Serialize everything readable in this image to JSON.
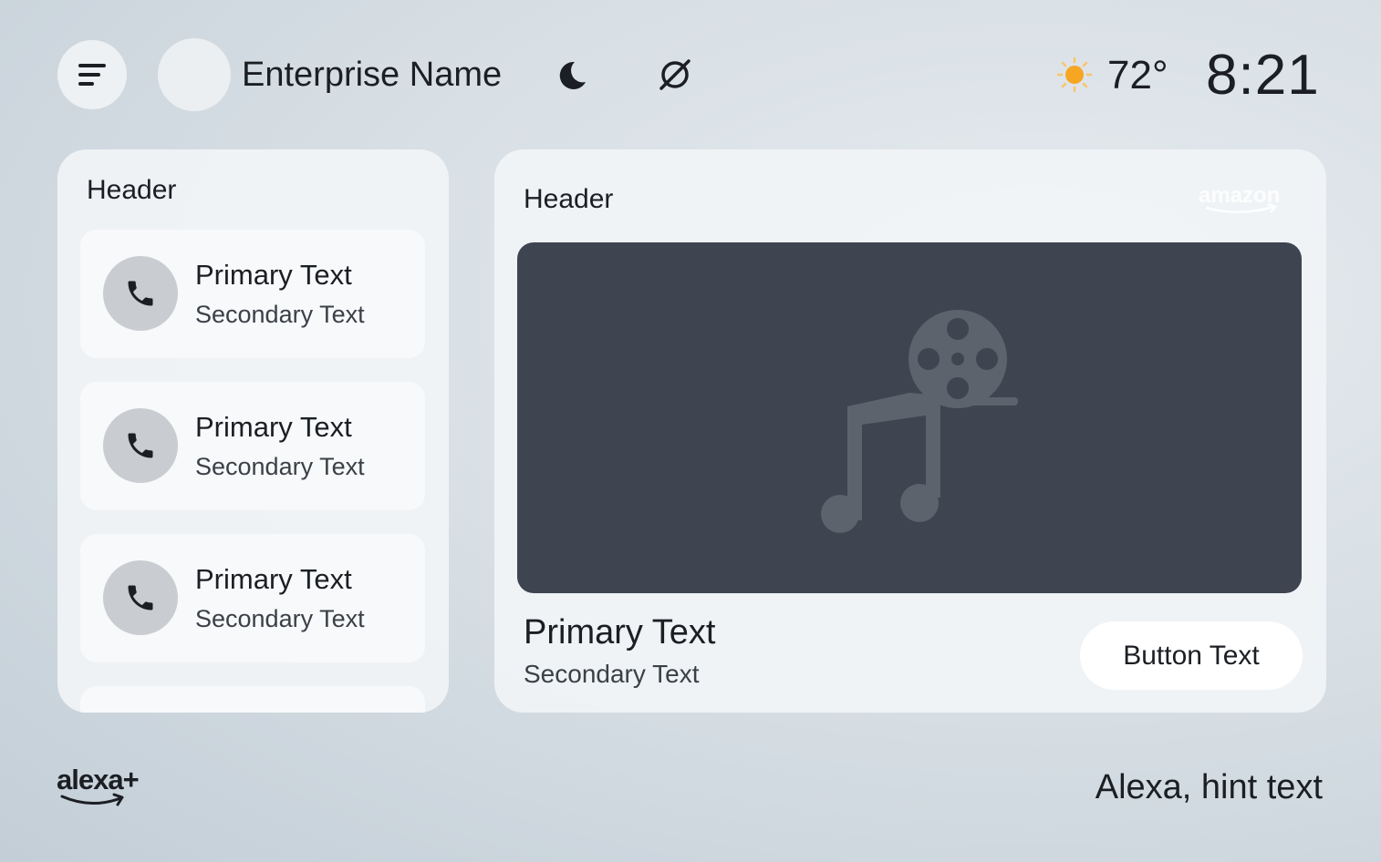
{
  "header": {
    "enterprise_name": "Enterprise Name",
    "temperature": "72°",
    "time": "8:21",
    "icons": {
      "menu": "menu-icon",
      "moon": "moon-icon",
      "dnd": "do-not-disturb-icon",
      "weather": "sun-icon"
    },
    "colors": {
      "sun": "#f6a623"
    }
  },
  "left_panel": {
    "header": "Header",
    "items": [
      {
        "primary": "Primary Text",
        "secondary": "Secondary Text",
        "icon": "phone-icon"
      },
      {
        "primary": "Primary Text",
        "secondary": "Secondary Text",
        "icon": "phone-icon"
      },
      {
        "primary": "Primary Text",
        "secondary": "Secondary Text",
        "icon": "phone-icon"
      }
    ]
  },
  "right_panel": {
    "header": "Header",
    "brand": "amazon",
    "media_icon": "music-film-placeholder-icon",
    "primary": "Primary Text",
    "secondary": "Secondary Text",
    "button": "Button Text"
  },
  "footer": {
    "logo": "alexa+",
    "hint": "Alexa, hint text"
  }
}
